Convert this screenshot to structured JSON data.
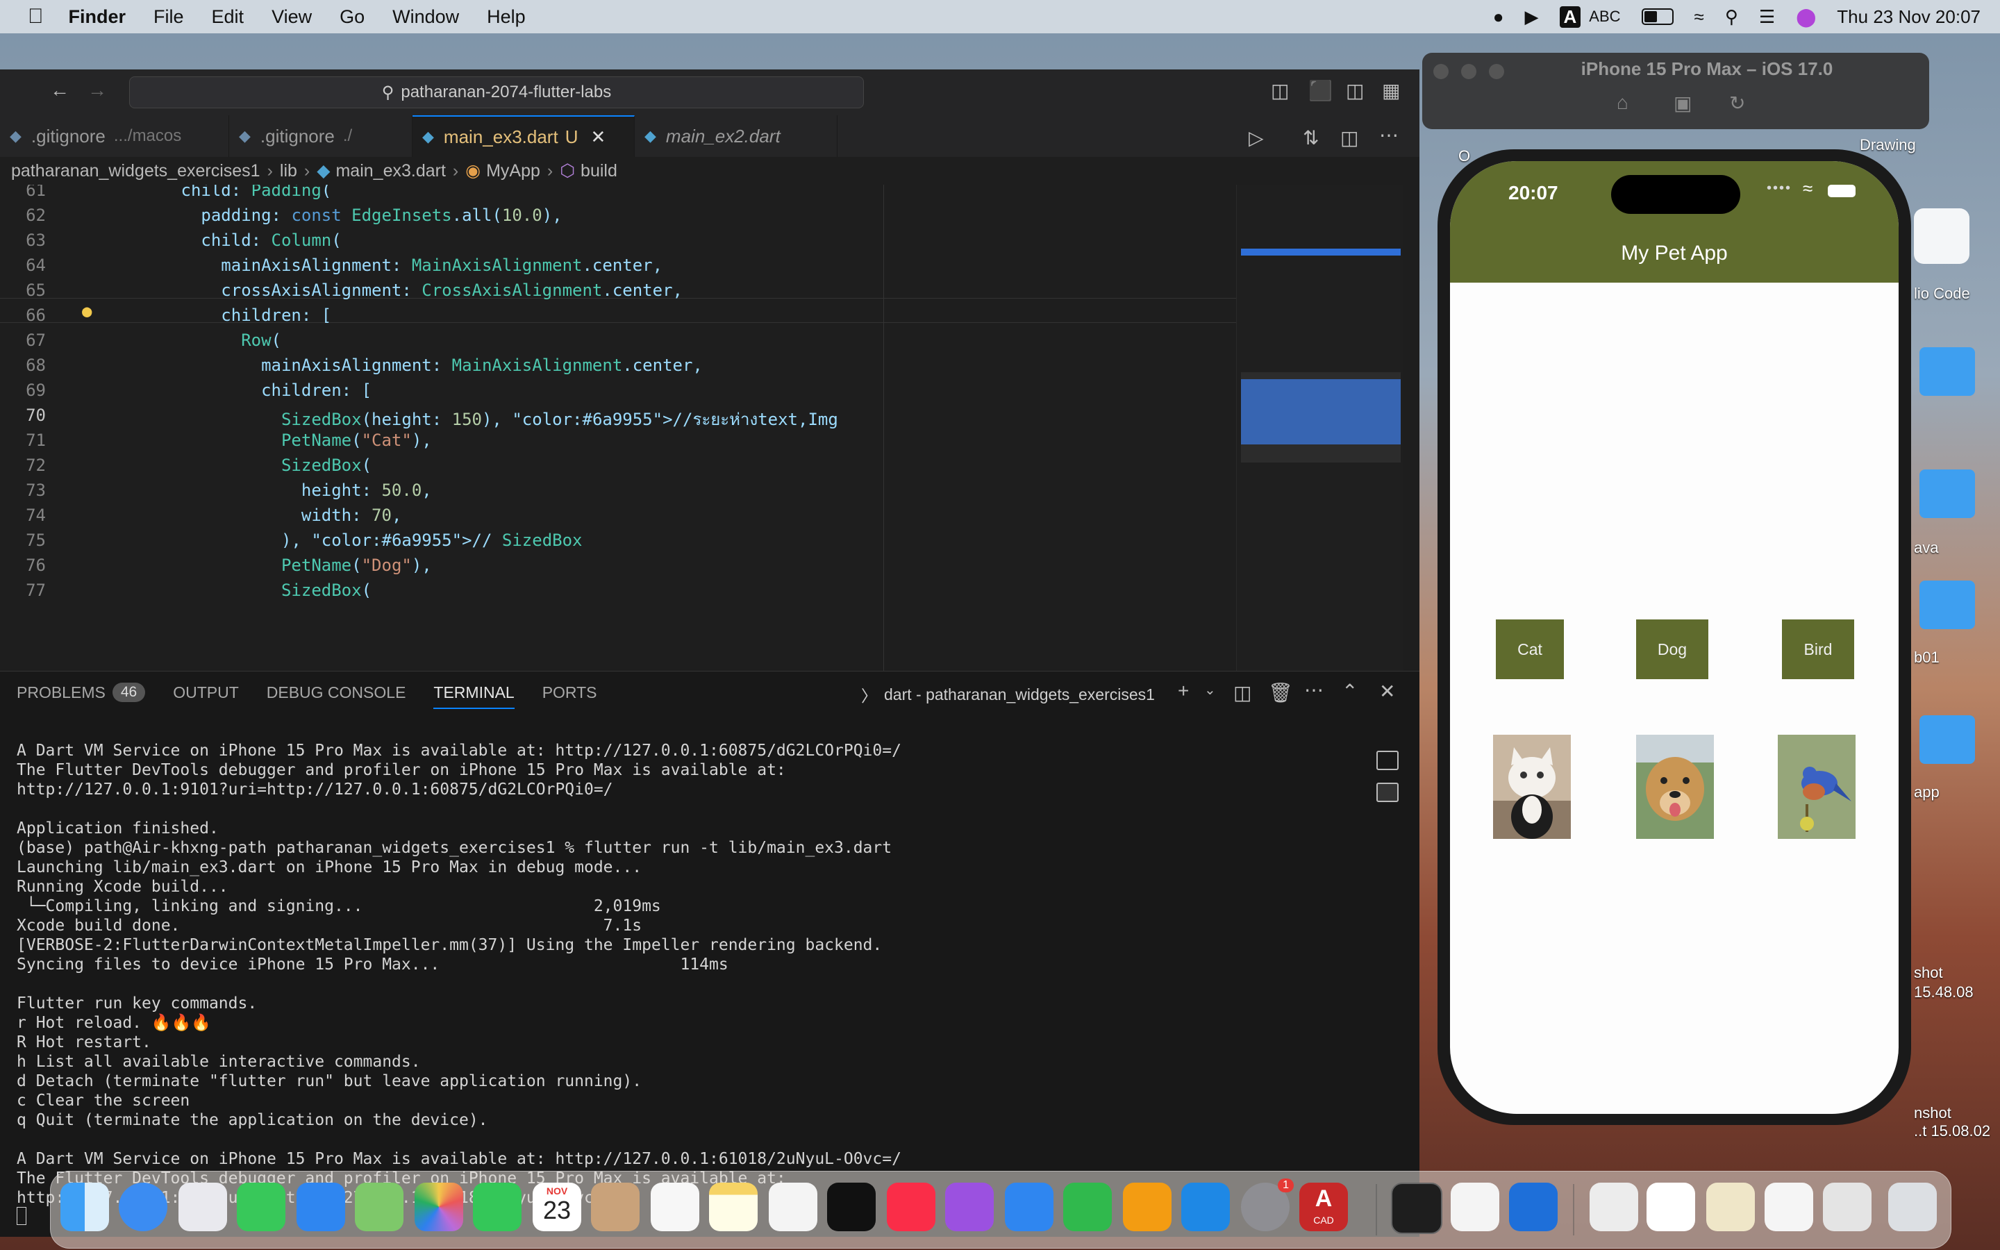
{
  "menubar": {
    "app": "Finder",
    "items": [
      "File",
      "Edit",
      "View",
      "Go",
      "Window",
      "Help"
    ],
    "input_source": "ABC",
    "input_badge": "A",
    "datetime": "Thu 23 Nov  20:07"
  },
  "vscode": {
    "search": "patharanan-2074-flutter-labs",
    "tabs": [
      {
        "name": ".gitignore",
        "hint": ".../macos"
      },
      {
        "name": ".gitignore",
        "hint": "./"
      },
      {
        "name": "main_ex3.dart",
        "hint": "U"
      },
      {
        "name": "main_ex2.dart",
        "hint": ""
      }
    ],
    "breadcrumb": [
      "patharanan_widgets_exercises1",
      "lib",
      "main_ex3.dart",
      "MyApp",
      "build"
    ],
    "code_lines": [
      {
        "n": "61",
        "t": "          child: Padding("
      },
      {
        "n": "62",
        "t": "            padding: const EdgeInsets.all(10.0),"
      },
      {
        "n": "63",
        "t": "            child: Column("
      },
      {
        "n": "64",
        "t": "              mainAxisAlignment: MainAxisAlignment.center,"
      },
      {
        "n": "65",
        "t": "              crossAxisAlignment: CrossAxisAlignment.center,"
      },
      {
        "n": "66",
        "t": "              children: ["
      },
      {
        "n": "67",
        "t": "                Row("
      },
      {
        "n": "68",
        "t": "                  mainAxisAlignment: MainAxisAlignment.center,"
      },
      {
        "n": "69",
        "t": "                  children: ["
      },
      {
        "n": "70",
        "t": "                    SizedBox(height: 150), //ระยะห่างtext,Img"
      },
      {
        "n": "71",
        "t": "                    PetName(\"Cat\"),"
      },
      {
        "n": "72",
        "t": "                    SizedBox("
      },
      {
        "n": "73",
        "t": "                      height: 50.0,"
      },
      {
        "n": "74",
        "t": "                      width: 70,"
      },
      {
        "n": "75",
        "t": "                    ), // SizedBox"
      },
      {
        "n": "76",
        "t": "                    PetName(\"Dog\"),"
      },
      {
        "n": "77",
        "t": "                    SizedBox("
      }
    ],
    "panel": {
      "tabs": [
        "PROBLEMS",
        "OUTPUT",
        "DEBUG CONSOLE",
        "TERMINAL",
        "PORTS"
      ],
      "problems_count": "46",
      "terminal_name": "dart - patharanan_widgets_exercises1"
    },
    "terminal_lines": [
      "A Dart VM Service on iPhone 15 Pro Max is available at: http://127.0.0.1:60875/dG2LCOrPQi0=/",
      "The Flutter DevTools debugger and profiler on iPhone 15 Pro Max is available at:",
      "http://127.0.0.1:9101?uri=http://127.0.0.1:60875/dG2LCOrPQi0=/",
      "",
      "Application finished.",
      "(base) path@Air-khxng-path patharanan_widgets_exercises1 % flutter run -t lib/main_ex3.dart",
      "Launching lib/main_ex3.dart on iPhone 15 Pro Max in debug mode...",
      "Running Xcode build...",
      " └─Compiling, linking and signing...                        2,019ms",
      "Xcode build done.                                            7.1s",
      "[VERBOSE-2:FlutterDarwinContextMetalImpeller.mm(37)] Using the Impeller rendering backend.",
      "Syncing files to device iPhone 15 Pro Max...                         114ms",
      "",
      "Flutter run key commands.",
      "r Hot reload. 🔥🔥🔥",
      "R Hot restart.",
      "h List all available interactive commands.",
      "d Detach (terminate \"flutter run\" but leave application running).",
      "c Clear the screen",
      "q Quit (terminate the application on the device).",
      "",
      "A Dart VM Service on iPhone 15 Pro Max is available at: http://127.0.0.1:61018/2uNyuL-O0vc=/",
      "The Flutter DevTools debugger and profiler on iPhone 15 Pro Max is available at:",
      "http://127.0.0.1:9101?uri=http://127.0.0.1:61018/2uNyuL-O0vc=/"
    ]
  },
  "simulator": {
    "title": "iPhone 15 Pro Max – iOS 17.0",
    "time": "20:07",
    "app_title": "My Pet App",
    "pets": [
      "Cat",
      "Dog",
      "Bird"
    ]
  },
  "desktop_labels": {
    "drawing": "Drawing",
    "studio_code": "lio Code",
    "java": "ava",
    "lab01": "b01",
    "app": "app",
    "shot1a": "shot",
    "shot1b": "15.48.08",
    "shot2a": "nshot",
    "shot2b": "..t 15.08.02",
    "o": "O"
  },
  "dock": {
    "calendar_month": "NOV",
    "calendar_day": "23",
    "settings_badge": "1",
    "cad_label": "CAD"
  }
}
